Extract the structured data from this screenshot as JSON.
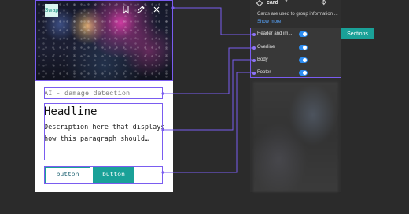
{
  "card": {
    "swap_label": "Swap",
    "icons": [
      "bookmark-icon",
      "pencil-icon",
      "close-icon"
    ],
    "overline": "AI - damage detection",
    "headline": "Headline",
    "description_lines": [
      "Description here that displays",
      "how this paragraph should…"
    ],
    "button_outline": "button",
    "button_filled": "button"
  },
  "panel": {
    "title": "card",
    "description": "Cards are used to group information ...",
    "show_more": "Show more",
    "properties": [
      {
        "label": "Header and im...",
        "enabled": true
      },
      {
        "label": "Overline",
        "enabled": true
      },
      {
        "label": "Body",
        "enabled": true
      },
      {
        "label": "Footer",
        "enabled": true
      }
    ]
  },
  "sections_label": "Sections",
  "colors": {
    "accent_teal": "#1aa198",
    "highlight_purple": "#7a5cf0",
    "toggle_blue": "#2c8df2",
    "link_blue": "#58a6ff"
  }
}
